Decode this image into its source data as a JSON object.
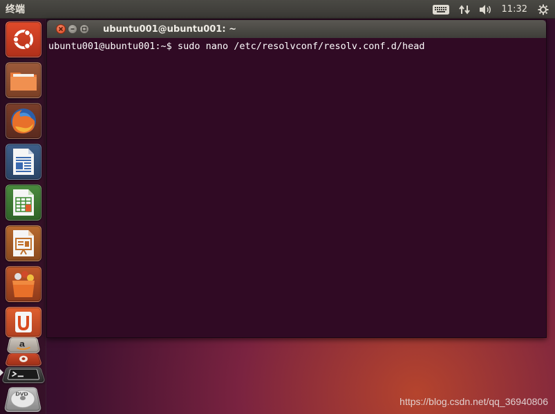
{
  "top_panel": {
    "app_title": "终端",
    "clock": "11:32",
    "icons": [
      "keyboard-icon",
      "network-icon",
      "volume-icon",
      "power-icon"
    ]
  },
  "launcher": {
    "items": [
      {
        "name": "dash-home",
        "icon": "ubuntu-logo-icon"
      },
      {
        "name": "files",
        "icon": "folder-icon"
      },
      {
        "name": "firefox",
        "icon": "firefox-icon"
      },
      {
        "name": "libreoffice-writer",
        "icon": "writer-icon"
      },
      {
        "name": "libreoffice-calc",
        "icon": "calc-icon"
      },
      {
        "name": "libreoffice-impress",
        "icon": "impress-icon"
      },
      {
        "name": "software-center",
        "icon": "shopping-bag-icon"
      },
      {
        "name": "ubuntu-one",
        "icon": "ubuntu-one-icon",
        "label": "U"
      },
      {
        "name": "amazon",
        "icon": "amazon-icon",
        "label": "a"
      },
      {
        "name": "system-settings",
        "icon": "settings-icon"
      },
      {
        "name": "terminal",
        "icon": "terminal-icon"
      },
      {
        "name": "dvd",
        "icon": "dvd-icon",
        "label": "DVD"
      }
    ]
  },
  "window": {
    "title": "ubuntu001@ubuntu001: ~",
    "prompt_line": "ubuntu001@ubuntu001:~$ sudo nano /etc/resolvconf/resolv.conf.d/head"
  },
  "watermark": "https://blog.csdn.net/qq_36940806",
  "colors": {
    "terminal_bg": "#300a24",
    "panel_bg": "#3c3b37",
    "close_button": "#df4a1f"
  }
}
